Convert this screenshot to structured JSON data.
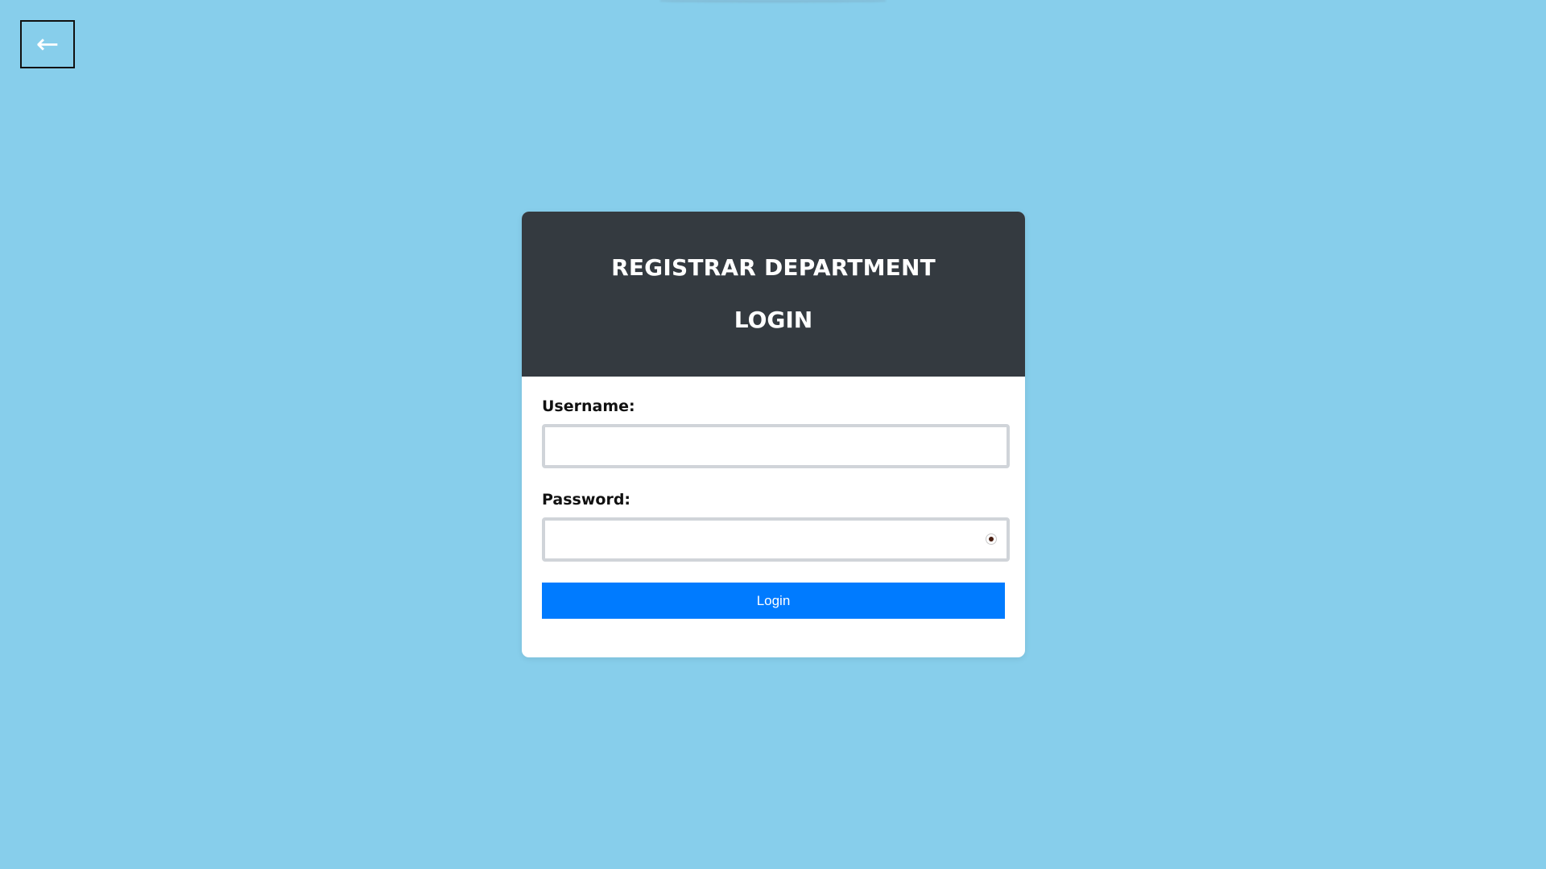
{
  "nav": {
    "back_label": "←"
  },
  "card": {
    "title": "REGISTRAR DEPARTMENT",
    "subtitle": "LOGIN"
  },
  "form": {
    "username_label": "Username:",
    "username_value": "",
    "password_label": "Password:",
    "password_value": "",
    "password_toggle_icon": "eye-icon",
    "submit_label": "Login"
  },
  "colors": {
    "background": "#87CEEB",
    "header": "#343a40",
    "primary": "#007bff"
  }
}
